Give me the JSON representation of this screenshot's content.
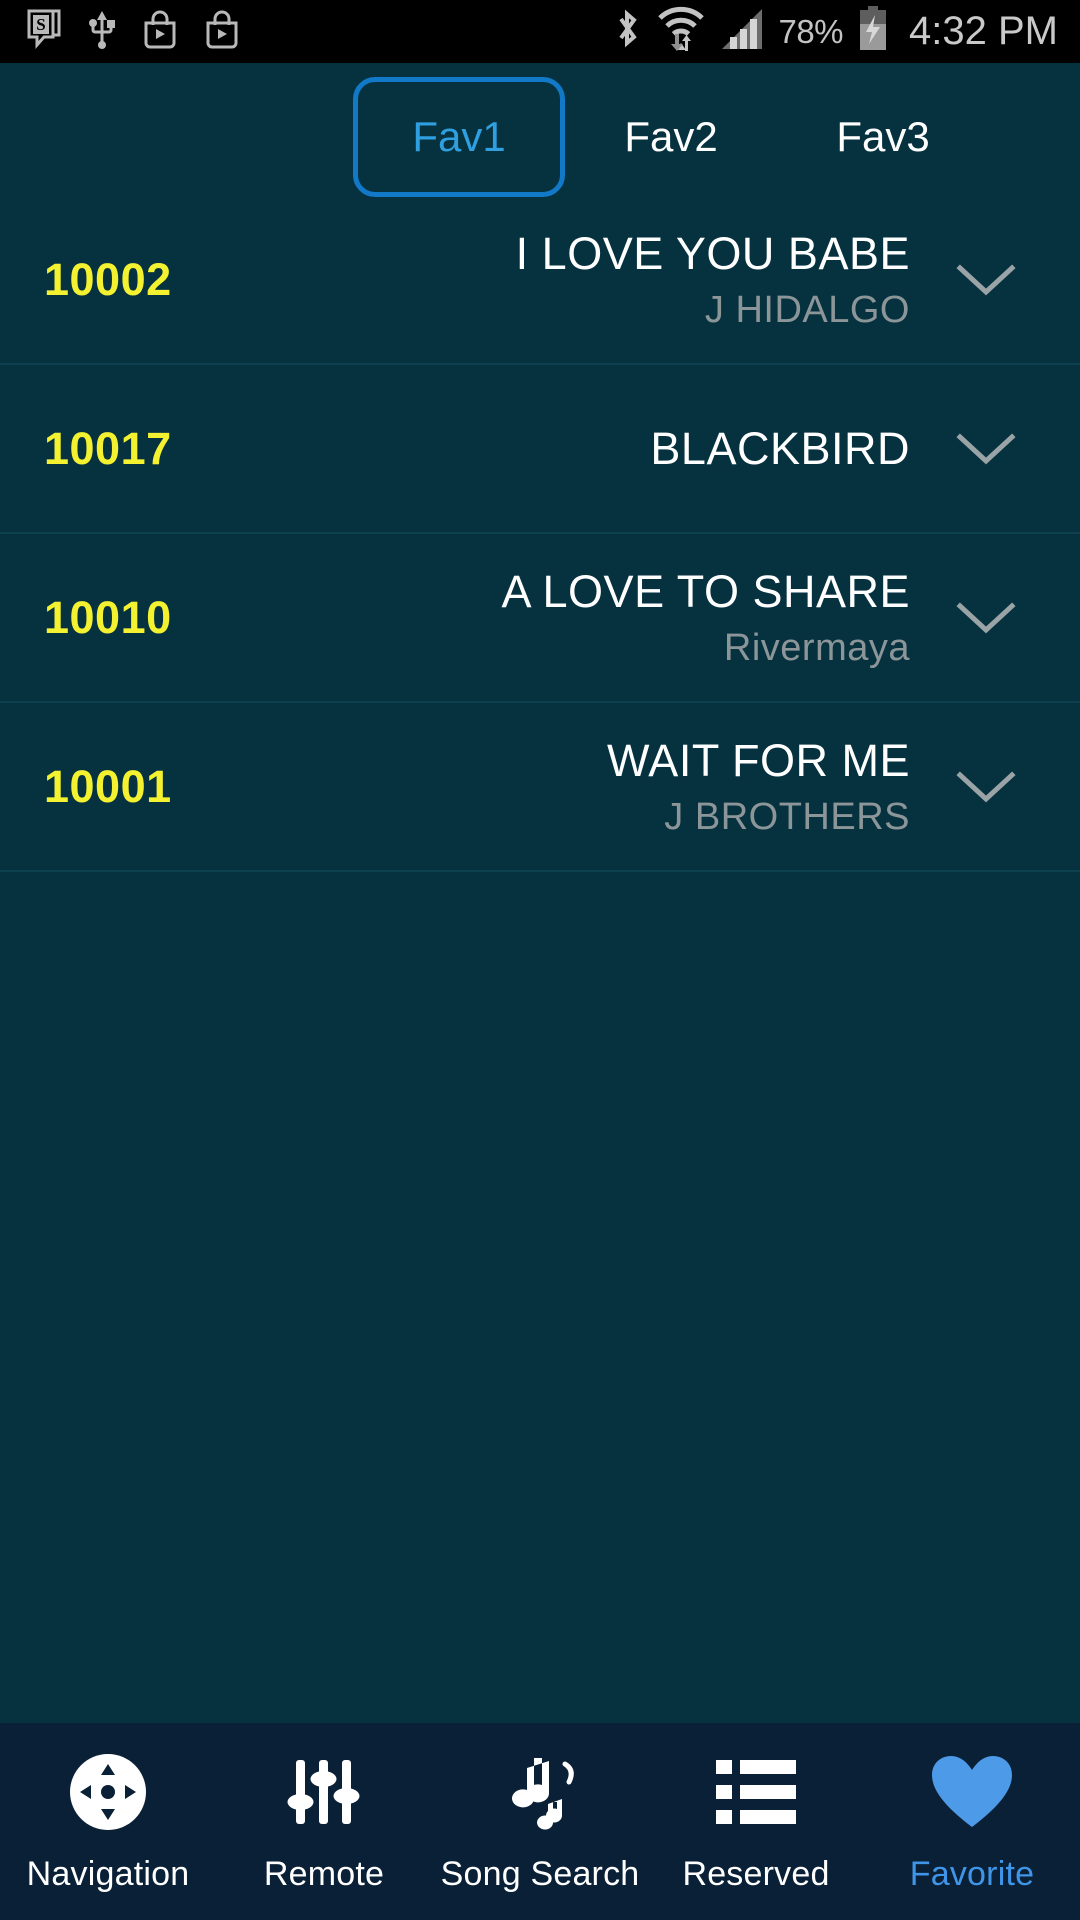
{
  "status_bar": {
    "left_icons": [
      "stumbleupon-notification-icon",
      "usb-icon",
      "play-store-bag-icon",
      "play-store-bag-icon"
    ],
    "bluetooth_icon": "bluetooth-icon",
    "wifi_icon": "wifi-transfer-icon",
    "signal_icon": "cellular-signal-icon",
    "battery_percent": "78%",
    "battery_icon": "battery-charging-icon",
    "clock": "4:32 PM"
  },
  "tabs": {
    "items": [
      {
        "label": "Fav1",
        "active": true
      },
      {
        "label": "Fav2",
        "active": false
      },
      {
        "label": "Fav3",
        "active": false
      }
    ]
  },
  "song_list": {
    "rows": [
      {
        "number": "10002",
        "title": "I LOVE YOU BABE",
        "artist": "J HIDALGO",
        "expand_icon": "chevron-down-icon"
      },
      {
        "number": "10017",
        "title": "BLACKBIRD",
        "artist": "",
        "expand_icon": "chevron-down-icon"
      },
      {
        "number": "10010",
        "title": "A LOVE TO SHARE",
        "artist": "Rivermaya",
        "expand_icon": "chevron-down-icon"
      },
      {
        "number": "10001",
        "title": "WAIT FOR ME",
        "artist": "J BROTHERS",
        "expand_icon": "chevron-down-icon"
      }
    ]
  },
  "bottom_nav": {
    "items": [
      {
        "label": "Navigation",
        "icon": "dpad-navigation-icon",
        "active": false
      },
      {
        "label": "Remote",
        "icon": "equalizer-sliders-icon",
        "active": false
      },
      {
        "label": "Song Search",
        "icon": "music-notes-icon",
        "active": false
      },
      {
        "label": "Reserved",
        "icon": "list-bullets-icon",
        "active": false
      },
      {
        "label": "Favorite",
        "icon": "heart-icon",
        "active": true
      }
    ]
  },
  "colors": {
    "background": "#063240",
    "accent_blue": "#1278c8",
    "tab_active_text": "#2f9fe0",
    "row_number_yellow": "#f4f230",
    "artist_gray": "#8c9699",
    "nav_bar_bg": "#0a2036",
    "nav_active": "#3f95e8",
    "status_bar_bg": "#000000"
  }
}
